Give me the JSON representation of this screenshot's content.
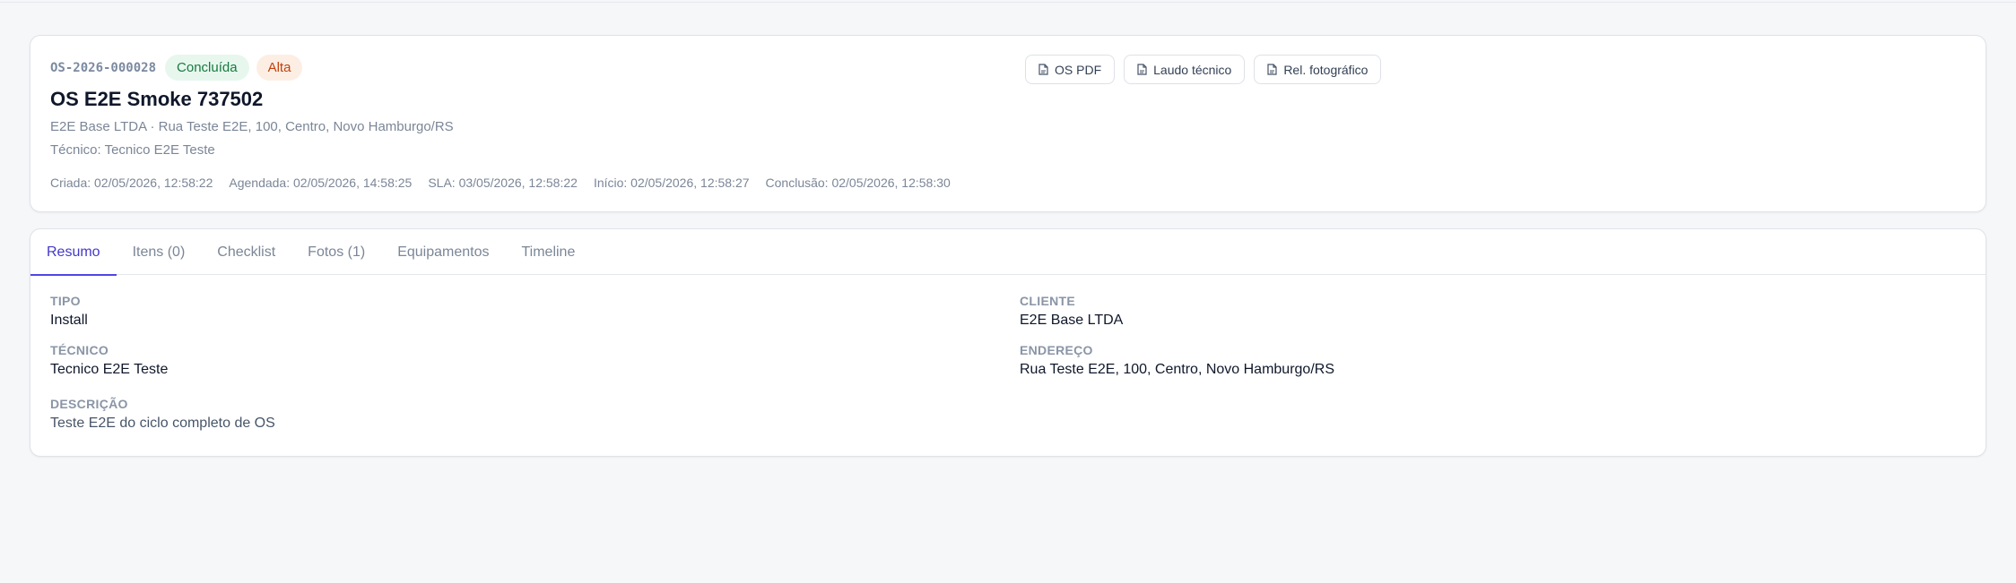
{
  "header": {
    "code": "OS-2026-000028",
    "status_badge": "Concluída",
    "priority_badge": "Alta",
    "title": "OS E2E Smoke 737502",
    "client_address": "E2E Base LTDA · Rua Teste E2E, 100, Centro, Novo Hamburgo/RS",
    "technician": "Técnico: Tecnico E2E Teste",
    "dates": [
      "Criada: 02/05/2026, 12:58:22",
      "Agendada: 02/05/2026, 14:58:25",
      "SLA: 03/05/2026, 12:58:22",
      "Início: 02/05/2026, 12:58:27",
      "Conclusão: 02/05/2026, 12:58:30"
    ],
    "actions": [
      "OS PDF",
      "Laudo técnico",
      "Rel. fotográfico"
    ]
  },
  "tabs": [
    "Resumo",
    "Itens (0)",
    "Checklist",
    "Fotos (1)",
    "Equipamentos",
    "Timeline"
  ],
  "active_tab": "Resumo",
  "summary": {
    "tipo_label": "TIPO",
    "tipo_value": "Install",
    "cliente_label": "CLIENTE",
    "cliente_value": "E2E Base LTDA",
    "tecnico_label": "TÉCNICO",
    "tecnico_value": "Tecnico E2E Teste",
    "endereco_label": "ENDEREÇO",
    "endereco_value": "Rua Teste E2E, 100, Centro, Novo Hamburgo/RS",
    "descricao_label": "DESCRIÇÃO",
    "descricao_value": "Teste E2E do ciclo completo de OS"
  },
  "colors": {
    "accent": "#4f46e5",
    "status_green": "#177a3e",
    "priority_orange": "#c2410c"
  },
  "icons": {
    "action_icon": "document-icon"
  }
}
